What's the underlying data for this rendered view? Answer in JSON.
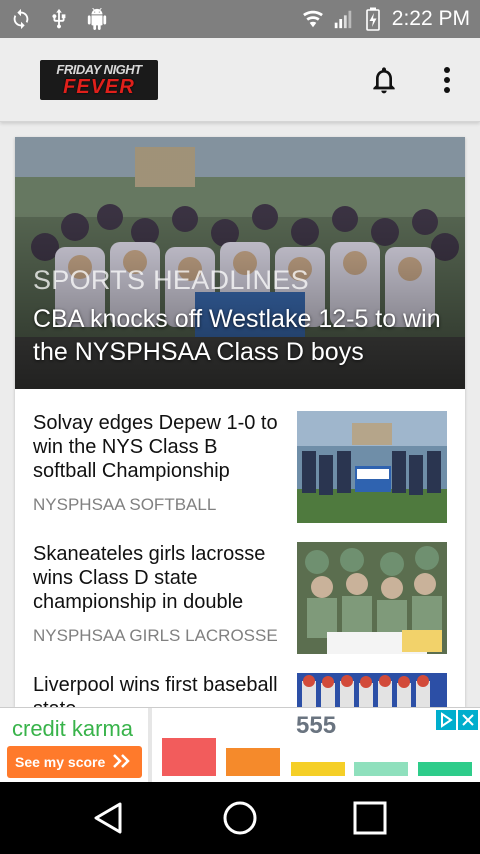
{
  "status_bar": {
    "time": "2:22 PM",
    "left_icons": [
      "sync-icon",
      "usb-icon",
      "android-debug-icon"
    ],
    "right_icons": [
      "wifi-icon",
      "signal-icon",
      "battery-charging-icon"
    ]
  },
  "app_bar": {
    "logo_line1": "FRIDAY NIGHT",
    "logo_line2": "FEVER",
    "notification_icon": "bell-icon",
    "overflow_icon": "more-vert-icon"
  },
  "hero": {
    "category": "SPORTS HEADLINES",
    "title": "CBA knocks off Westlake 12-5 to win the NYSPHSAA Class D boys"
  },
  "articles": [
    {
      "title": "Solvay edges Depew 1-0 to win the NYS Class B softball Championship",
      "category": "NYSPHSAA SOFTBALL"
    },
    {
      "title": "Skaneateles girls lacrosse wins Class D state championship in double",
      "category": "NYSPHSAA GIRLS LACROSSE"
    },
    {
      "title": "Liverpool wins first baseball state",
      "category": ""
    }
  ],
  "ad": {
    "brand": "credit karma",
    "cta": "See my score",
    "score": "555",
    "colors": [
      "#f25c5c",
      "#f58a2b",
      "#f5cf27",
      "#8fe0bd",
      "#2ecc8a"
    ]
  },
  "nav": {
    "back_icon": "back-icon",
    "home_icon": "home-icon",
    "recents_icon": "recents-icon"
  }
}
